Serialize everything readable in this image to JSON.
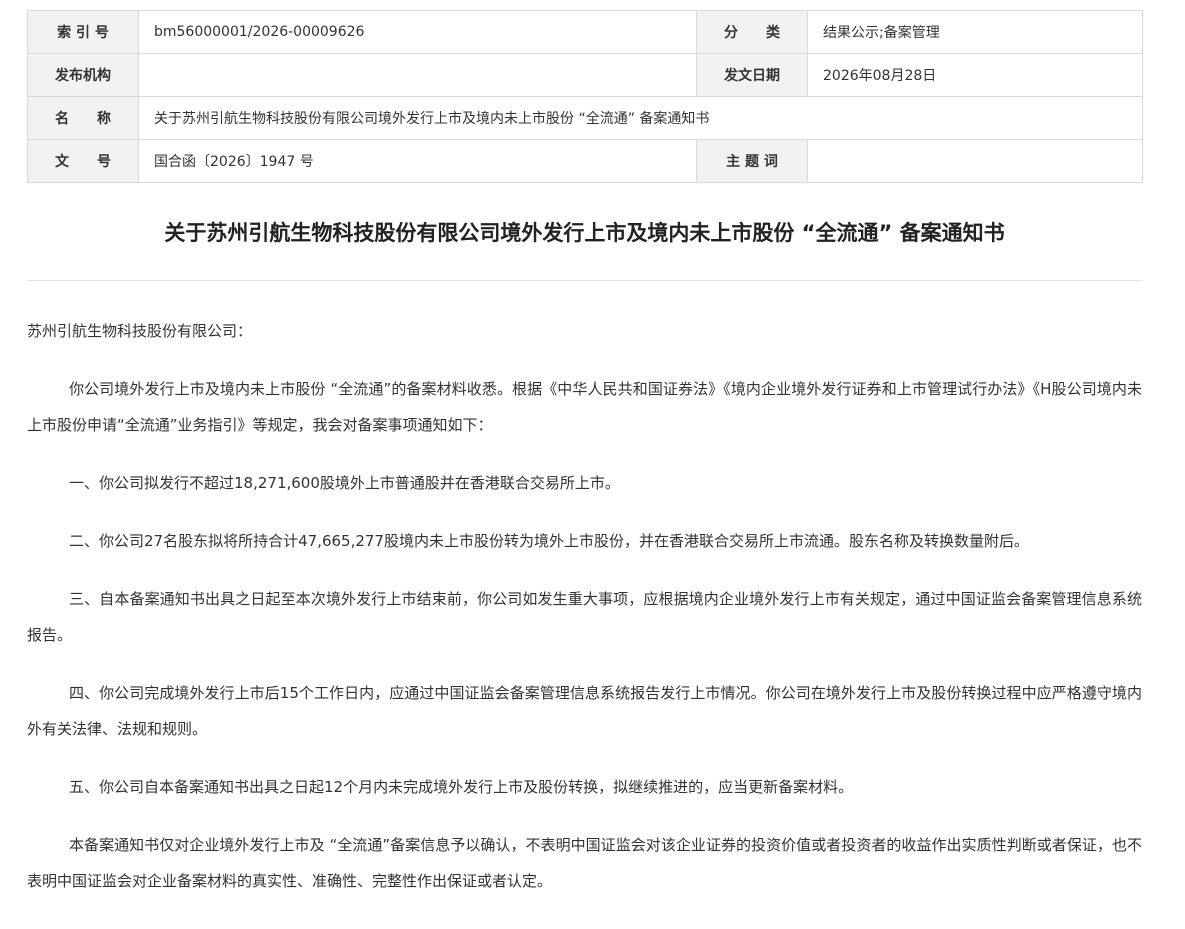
{
  "meta": {
    "index_label": "索 引 号",
    "index_value": "bm56000001/2026-00009626",
    "category_label": "分　　类",
    "category_value": "结果公示;备案管理",
    "issuer_label": "发布机构",
    "issuer_value": "",
    "date_label": "发文日期",
    "date_value": "2026年08月28日",
    "name_label": "名　　称",
    "name_value": "关于苏州引航生物科技股份有限公司境外发行上市及境内未上市股份 “全流通” 备案通知书",
    "docno_label": "文　　号",
    "docno_value": "国合函〔2026〕1947 号",
    "subject_label": "主 题 词",
    "subject_value": ""
  },
  "document": {
    "title": "关于苏州引航生物科技股份有限公司境外发行上市及境内未上市股份 “全流通” 备案通知书",
    "greeting": "苏州引航生物科技股份有限公司：",
    "paragraphs": [
      "你公司境外发行上市及境内未上市股份 “全流通”的备案材料收悉。根据《中华人民共和国证券法》《境内企业境外发行证券和上市管理试行办法》《H股公司境内未上市股份申请“全流通”业务指引》等规定，我会对备案事项通知如下：",
      "一、你公司拟发行不超过18,271,600股境外上市普通股并在香港联合交易所上市。",
      "二、你公司27名股东拟将所持合计47,665,277股境内未上市股份转为境外上市股份，并在香港联合交易所上市流通。股东名称及转换数量附后。",
      "三、自本备案通知书出具之日起至本次境外发行上市结束前，你公司如发生重大事项，应根据境内企业境外发行上市有关规定，通过中国证监会备案管理信息系统报告。",
      "四、你公司完成境外发行上市后15个工作日内，应通过中国证监会备案管理信息系统报告发行上市情况。你公司在境外发行上市及股份转换过程中应严格遵守境内外有关法律、法规和规则。",
      "五、你公司自本备案通知书出具之日起12个月内未完成境外发行上市及股份转换，拟继续推进的，应当更新备案材料。",
      "本备案通知书仅对企业境外发行上市及 “全流通”备案信息予以确认，不表明中国证监会对该企业证券的投资价值或者投资者的收益作出实质性判断或者保证，也不表明中国证监会对企业备案材料的真实性、准确性、完整性作出保证或者认定。"
    ]
  }
}
